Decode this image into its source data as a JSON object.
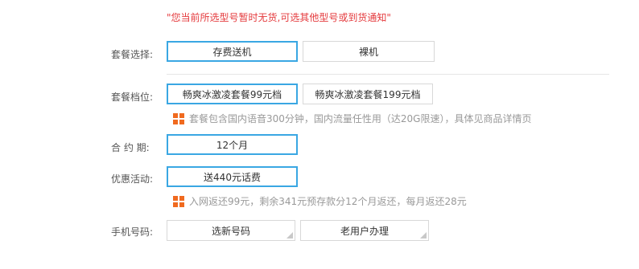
{
  "notice": "\"您当前所选型号暂时无货,可选其他型号或到货通知\"",
  "package": {
    "label": "套餐选择:",
    "options": [
      "存费送机",
      "裸机"
    ],
    "selected": 0
  },
  "plan": {
    "label": "套餐档位:",
    "options": [
      "畅爽冰激凌套餐99元档",
      "畅爽冰激凌套餐199元档"
    ],
    "selected": 0,
    "tip": "套餐包含国内语音300分钟，国内流量任性用（达20G限速），具体见商品详情页"
  },
  "contract": {
    "label": "合 约 期:",
    "value": "12个月"
  },
  "promo": {
    "label": "优惠活动:",
    "value": "送440元话费",
    "tip": "入网返还99元，剩余341元预存款分12个月返还，每月返还28元"
  },
  "phone": {
    "label": "手机号码:",
    "options": [
      "选新号码",
      "老用户办理"
    ]
  },
  "colors": {
    "accent_border": "#3aa7e3",
    "notice_red": "#e4393c",
    "icon_orange": "#f06a1f"
  },
  "icons": {
    "tip_icon": "windows-grid-icon",
    "corner_icon": "corner-triangle-icon"
  }
}
